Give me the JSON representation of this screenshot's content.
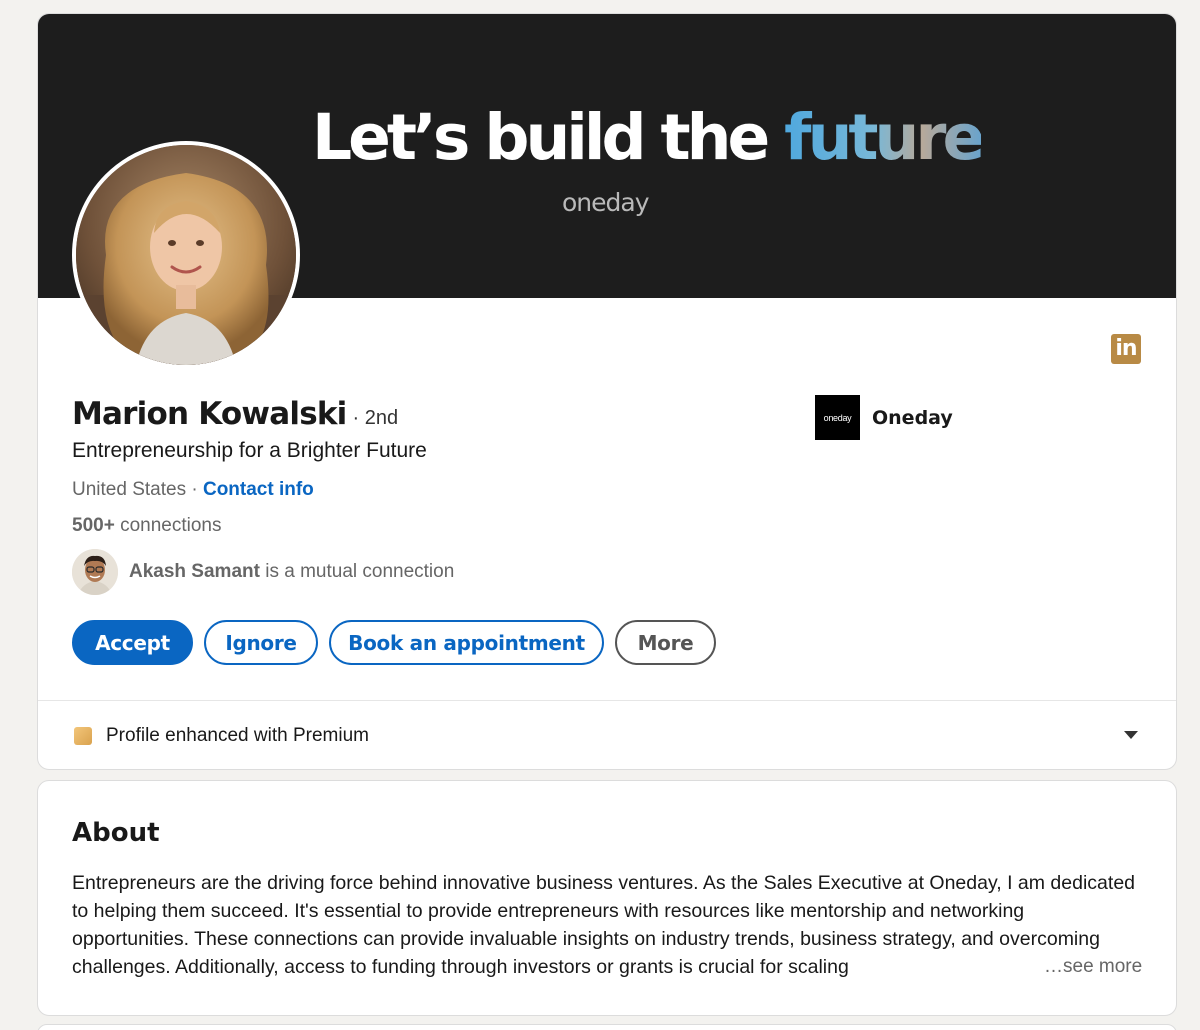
{
  "banner": {
    "headline_main": "Let’s build the ",
    "headline_accent": "future",
    "brand": "oneday"
  },
  "profile": {
    "name": "Marion Kowalski",
    "degree": "· 2nd",
    "headline": "Entrepreneurship for a Brighter Future",
    "location": "United States",
    "separator": " · ",
    "contact_link": "Contact info",
    "connections_count": "500+",
    "connections_label": " connections",
    "mutual": {
      "name": "Akash Samant",
      "text": " is a mutual connection"
    }
  },
  "company": {
    "logo_text": "oneday",
    "name": "Oneday"
  },
  "social_badge": "in",
  "actions": {
    "accept": "Accept",
    "ignore": "Ignore",
    "book": "Book an appointment",
    "more": "More"
  },
  "premium": {
    "text": "Profile enhanced with Premium"
  },
  "about": {
    "title": "About",
    "text": "Entrepreneurs are the driving force behind innovative business ventures. As the Sales Executive at Oneday, I am dedicated to helping them succeed. It's essential to provide entrepreneurs with resources like mentorship and networking opportunities. These connections can provide invaluable insights on industry trends, business strategy, and overcoming challenges. Additionally, access to funding through investors or grants is crucial for scaling",
    "see_more": "…see more"
  },
  "colors": {
    "brand_blue": "#0a66c2",
    "banner_bg": "#1d1d1d",
    "badge_gold": "#b88a45",
    "page_bg": "#f3f2ef"
  }
}
